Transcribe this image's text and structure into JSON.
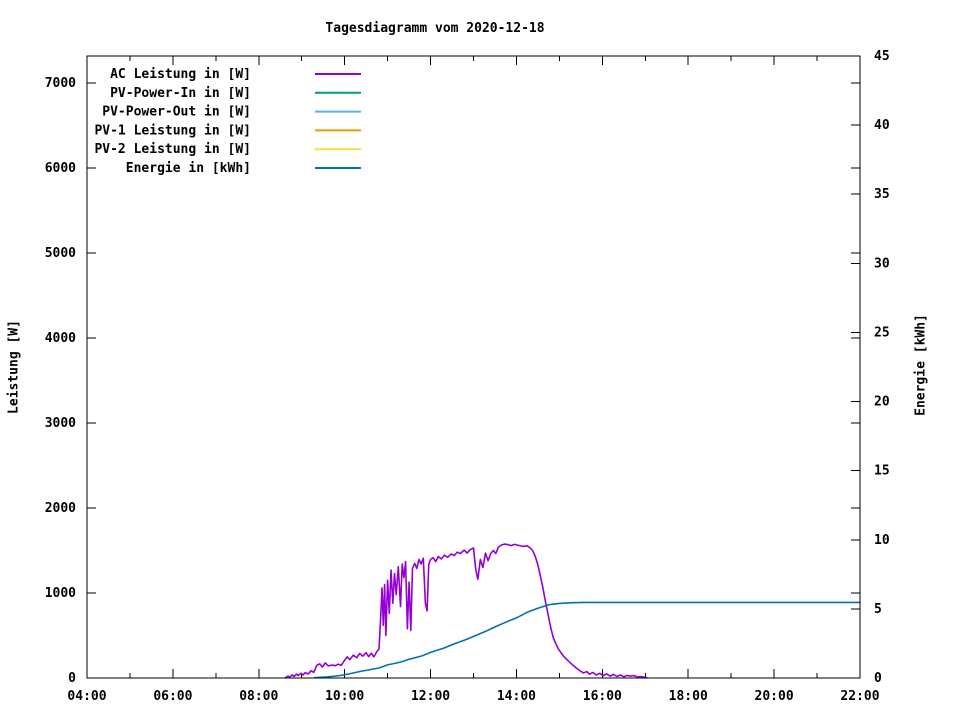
{
  "chart_data": {
    "type": "line",
    "title": "Tagesdiagramm vom 2020-12-18",
    "grid": false,
    "x_axis": {
      "range": [
        4,
        22
      ],
      "unit": "time of day",
      "major_tick_values": [
        4,
        6,
        8,
        10,
        12,
        14,
        16,
        18,
        20,
        22
      ],
      "major_tick_labels": [
        "04:00",
        "06:00",
        "08:00",
        "10:00",
        "12:00",
        "14:00",
        "16:00",
        "18:00",
        "20:00",
        "22:00"
      ],
      "minor_tick_values": [
        5,
        7,
        9,
        11,
        13,
        15,
        17,
        19,
        21
      ]
    },
    "y1_axis": {
      "label": "Leistung [W]",
      "range": [
        0,
        7318
      ],
      "tick_values": [
        0,
        1000,
        2000,
        3000,
        4000,
        5000,
        6000,
        7000
      ],
      "tick_labels": [
        "0",
        "1000",
        "2000",
        "3000",
        "4000",
        "5000",
        "6000",
        "7000"
      ]
    },
    "y2_axis": {
      "label": "Energie [kWh]",
      "range": [
        0,
        45
      ],
      "tick_values": [
        0,
        5,
        10,
        15,
        20,
        25,
        30,
        35,
        40,
        45
      ],
      "tick_labels": [
        "0",
        "5",
        "10",
        "15",
        "20",
        "25",
        "30",
        "35",
        "40",
        "45"
      ]
    },
    "legend": {
      "position": "top-left-inside",
      "entries": [
        {
          "label": "AC Leistung in [W]",
          "color": "#9400d3"
        },
        {
          "label": "PV-Power-In in [W]",
          "color": "#009e73"
        },
        {
          "label": "PV-Power-Out in [W]",
          "color": "#56b4e9"
        },
        {
          "label": "PV-1 Leistung in [W]",
          "color": "#e69f00"
        },
        {
          "label": "PV-2 Leistung in [W]",
          "color": "#f0e442"
        },
        {
          "label": "Energie in [kWh]",
          "color": "#0072b2"
        }
      ]
    },
    "series": [
      {
        "name": "AC Leistung in [W]",
        "color": "#9400d3",
        "y_axis": "y1",
        "points": [
          [
            8.62,
            4
          ],
          [
            8.68,
            22
          ],
          [
            8.72,
            10
          ],
          [
            8.78,
            38
          ],
          [
            8.82,
            18
          ],
          [
            8.88,
            46
          ],
          [
            8.92,
            30
          ],
          [
            8.98,
            55
          ],
          [
            9.03,
            36
          ],
          [
            9.08,
            62
          ],
          [
            9.15,
            48
          ],
          [
            9.22,
            86
          ],
          [
            9.28,
            66
          ],
          [
            9.35,
            150
          ],
          [
            9.42,
            166
          ],
          [
            9.48,
            130
          ],
          [
            9.55,
            178
          ],
          [
            9.62,
            142
          ],
          [
            9.7,
            152
          ],
          [
            9.78,
            145
          ],
          [
            9.85,
            162
          ],
          [
            9.92,
            150
          ],
          [
            10.0,
            210
          ],
          [
            10.06,
            248
          ],
          [
            10.12,
            216
          ],
          [
            10.2,
            268
          ],
          [
            10.28,
            240
          ],
          [
            10.35,
            288
          ],
          [
            10.42,
            256
          ],
          [
            10.5,
            298
          ],
          [
            10.56,
            252
          ],
          [
            10.62,
            292
          ],
          [
            10.68,
            248
          ],
          [
            10.75,
            312
          ],
          [
            10.8,
            340
          ],
          [
            10.84,
            720
          ],
          [
            10.87,
            1060
          ],
          [
            10.9,
            620
          ],
          [
            10.93,
            1100
          ],
          [
            10.96,
            500
          ],
          [
            11.0,
            1150
          ],
          [
            11.04,
            760
          ],
          [
            11.08,
            1270
          ],
          [
            11.12,
            880
          ],
          [
            11.16,
            1230
          ],
          [
            11.2,
            980
          ],
          [
            11.25,
            1310
          ],
          [
            11.3,
            840
          ],
          [
            11.34,
            1340
          ],
          [
            11.38,
            1180
          ],
          [
            11.42,
            1370
          ],
          [
            11.46,
            580
          ],
          [
            11.5,
            1130
          ],
          [
            11.54,
            560
          ],
          [
            11.58,
            1290
          ],
          [
            11.63,
            1350
          ],
          [
            11.68,
            1290
          ],
          [
            11.73,
            1395
          ],
          [
            11.78,
            1340
          ],
          [
            11.83,
            1410
          ],
          [
            11.88,
            880
          ],
          [
            11.92,
            790
          ],
          [
            11.96,
            1340
          ],
          [
            12.0,
            1395
          ],
          [
            12.06,
            1415
          ],
          [
            12.12,
            1370
          ],
          [
            12.18,
            1430
          ],
          [
            12.25,
            1400
          ],
          [
            12.32,
            1445
          ],
          [
            12.4,
            1420
          ],
          [
            12.48,
            1460
          ],
          [
            12.55,
            1440
          ],
          [
            12.62,
            1480
          ],
          [
            12.7,
            1465
          ],
          [
            12.78,
            1505
          ],
          [
            12.85,
            1470
          ],
          [
            12.92,
            1510
          ],
          [
            13.0,
            1530
          ],
          [
            13.05,
            1290
          ],
          [
            13.1,
            1160
          ],
          [
            13.16,
            1395
          ],
          [
            13.22,
            1300
          ],
          [
            13.28,
            1470
          ],
          [
            13.34,
            1380
          ],
          [
            13.4,
            1465
          ],
          [
            13.46,
            1500
          ],
          [
            13.52,
            1465
          ],
          [
            13.58,
            1540
          ],
          [
            13.65,
            1565
          ],
          [
            13.72,
            1575
          ],
          [
            13.8,
            1570
          ],
          [
            13.88,
            1558
          ],
          [
            13.95,
            1572
          ],
          [
            14.05,
            1560
          ],
          [
            14.15,
            1548
          ],
          [
            14.25,
            1555
          ],
          [
            14.32,
            1530
          ],
          [
            14.38,
            1495
          ],
          [
            14.44,
            1430
          ],
          [
            14.5,
            1330
          ],
          [
            14.56,
            1195
          ],
          [
            14.62,
            1050
          ],
          [
            14.68,
            890
          ],
          [
            14.74,
            740
          ],
          [
            14.8,
            590
          ],
          [
            14.86,
            470
          ],
          [
            14.92,
            400
          ],
          [
            14.98,
            340
          ],
          [
            15.04,
            295
          ],
          [
            15.1,
            255
          ],
          [
            15.16,
            225
          ],
          [
            15.24,
            185
          ],
          [
            15.32,
            150
          ],
          [
            15.4,
            115
          ],
          [
            15.48,
            85
          ],
          [
            15.56,
            60
          ],
          [
            15.64,
            75
          ],
          [
            15.7,
            45
          ],
          [
            15.78,
            65
          ],
          [
            15.86,
            35
          ],
          [
            15.94,
            55
          ],
          [
            16.02,
            28
          ],
          [
            16.1,
            48
          ],
          [
            16.18,
            22
          ],
          [
            16.26,
            42
          ],
          [
            16.34,
            18
          ],
          [
            16.42,
            35
          ],
          [
            16.5,
            15
          ],
          [
            16.58,
            30
          ],
          [
            16.66,
            22
          ],
          [
            16.74,
            28
          ],
          [
            16.82,
            12
          ],
          [
            16.9,
            18
          ],
          [
            16.98,
            8
          ],
          [
            17.04,
            3
          ]
        ]
      },
      {
        "name": "PV-Power-In in [W]",
        "color": "#009e73",
        "y_axis": "y1",
        "points": []
      },
      {
        "name": "PV-Power-Out in [W]",
        "color": "#56b4e9",
        "y_axis": "y1",
        "points": []
      },
      {
        "name": "PV-1 Leistung in [W]",
        "color": "#e69f00",
        "y_axis": "y1",
        "points": []
      },
      {
        "name": "PV-2 Leistung in [W]",
        "color": "#f0e442",
        "y_axis": "y1",
        "points": []
      },
      {
        "name": "Energie in [kWh]",
        "color": "#0072b2",
        "y_axis": "y2",
        "points": [
          [
            9.3,
            0.02
          ],
          [
            9.6,
            0.08
          ],
          [
            9.9,
            0.18
          ],
          [
            10.1,
            0.3
          ],
          [
            10.4,
            0.5
          ],
          [
            10.8,
            0.72
          ],
          [
            11.0,
            0.95
          ],
          [
            11.3,
            1.15
          ],
          [
            11.5,
            1.35
          ],
          [
            11.8,
            1.6
          ],
          [
            12.0,
            1.85
          ],
          [
            12.3,
            2.15
          ],
          [
            12.5,
            2.4
          ],
          [
            12.8,
            2.75
          ],
          [
            13.0,
            3.0
          ],
          [
            13.3,
            3.4
          ],
          [
            13.5,
            3.7
          ],
          [
            13.8,
            4.1
          ],
          [
            14.0,
            4.35
          ],
          [
            14.25,
            4.75
          ],
          [
            14.5,
            5.05
          ],
          [
            14.75,
            5.3
          ],
          [
            15.0,
            5.4
          ],
          [
            15.3,
            5.45
          ],
          [
            15.6,
            5.47
          ],
          [
            16.0,
            5.47
          ],
          [
            17.0,
            5.47
          ],
          [
            18.0,
            5.47
          ],
          [
            19.0,
            5.47
          ],
          [
            20.0,
            5.47
          ],
          [
            21.0,
            5.47
          ],
          [
            22.0,
            5.47
          ]
        ]
      }
    ]
  },
  "colors": {
    "background": "#ffffff",
    "foreground": "#000000"
  }
}
